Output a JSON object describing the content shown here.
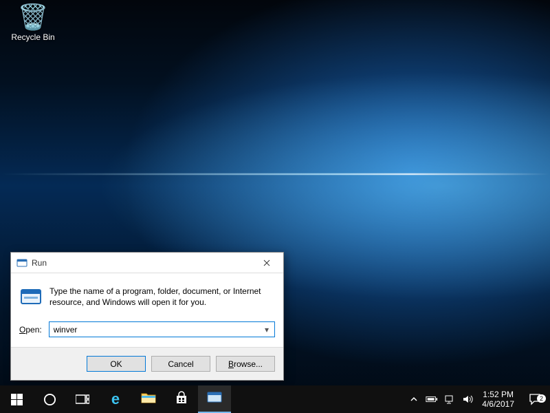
{
  "desktop": {
    "recycle_bin_label": "Recycle Bin"
  },
  "run": {
    "title": "Run",
    "message": "Type the name of a program, folder, document, or Internet resource, and Windows will open it for you.",
    "open_label": "Open:",
    "open_value": "winver",
    "ok": "OK",
    "cancel": "Cancel",
    "browse": "Browse..."
  },
  "tray": {
    "time": "1:52 PM",
    "date": "4/6/2017",
    "notifications": "2"
  }
}
